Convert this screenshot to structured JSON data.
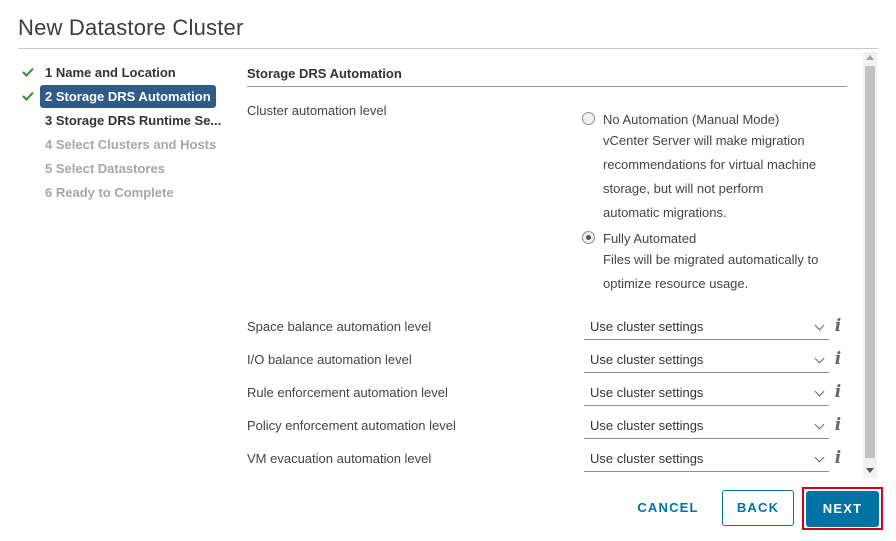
{
  "dialog": {
    "title": "New Datastore Cluster"
  },
  "steps": [
    {
      "label": "1 Name and Location",
      "state": "done"
    },
    {
      "label": "2 Storage DRS Automation",
      "state": "active"
    },
    {
      "label": "3 Storage DRS Runtime Se...",
      "state": "next"
    },
    {
      "label": "4 Select Clusters and Hosts",
      "state": "disabled"
    },
    {
      "label": "5 Select Datastores",
      "state": "disabled"
    },
    {
      "label": "6 Ready to Complete",
      "state": "disabled"
    }
  ],
  "section": {
    "title": "Storage DRS Automation"
  },
  "cluster_automation": {
    "label": "Cluster automation level",
    "options": [
      {
        "title": "No Automation (Manual Mode)",
        "desc_lines": [
          "vCenter Server will make migration",
          "recommendations for virtual machine",
          "storage, but will not perform",
          "automatic migrations."
        ],
        "selected": false
      },
      {
        "title": "Fully Automated",
        "desc_lines": [
          "Files will be migrated automatically to",
          "optimize resource usage."
        ],
        "selected": true
      }
    ]
  },
  "settings": [
    {
      "label": "Space balance automation level",
      "value": "Use cluster settings"
    },
    {
      "label": "I/O balance automation level",
      "value": "Use cluster settings"
    },
    {
      "label": "Rule enforcement automation level",
      "value": "Use cluster settings"
    },
    {
      "label": "Policy enforcement automation level",
      "value": "Use cluster settings"
    },
    {
      "label": "VM evacuation automation level",
      "value": "Use cluster settings"
    }
  ],
  "info_glyph": "i",
  "buttons": {
    "cancel": "CANCEL",
    "back": "BACK",
    "next": "NEXT"
  },
  "colors": {
    "accent": "#0072a3",
    "active_step": "#2e5b8a",
    "check": "#2f8a30",
    "highlight": "#d0021b"
  }
}
